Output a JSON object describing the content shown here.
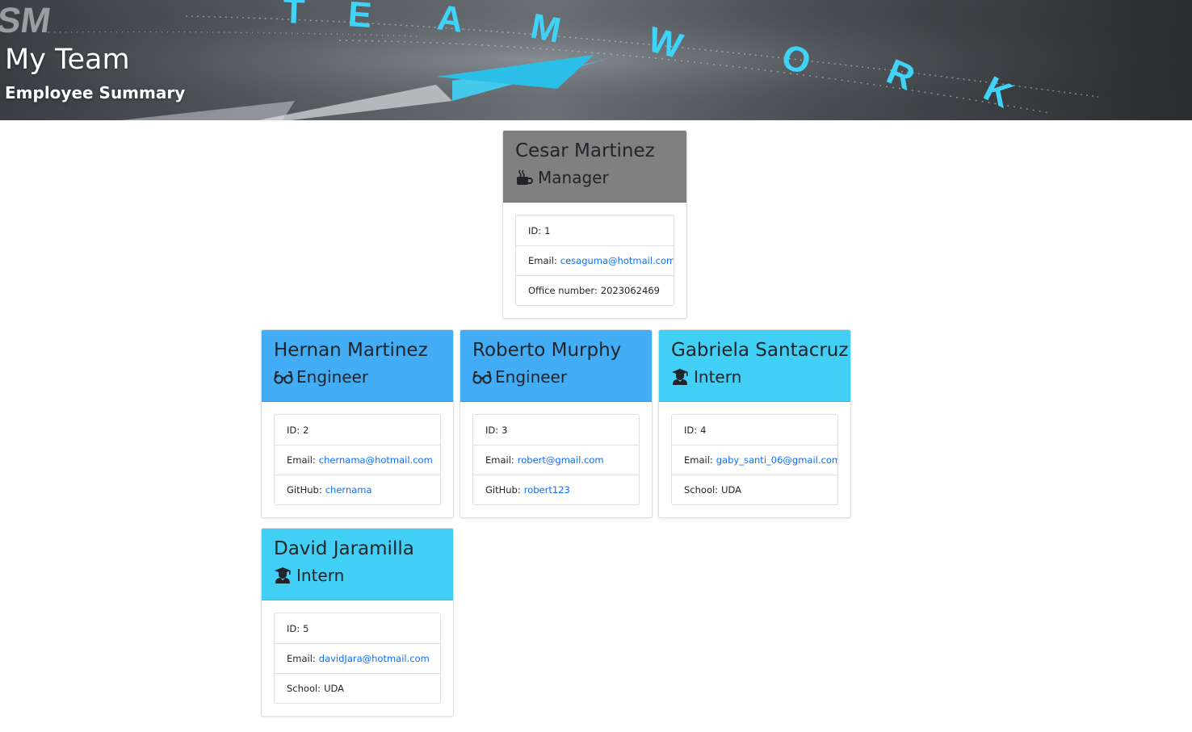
{
  "header": {
    "title": "My Team",
    "subtitle": "Employee Summary",
    "banner_text": "TEAMWORK"
  },
  "colors": {
    "manager_header": "#808080",
    "engineer_header": "#42adf5",
    "intern_header": "#42cff5",
    "link": "#0d6efd"
  },
  "labels": {
    "id": "ID:",
    "email": "Email:",
    "office": "Office number:",
    "github": "GitHub:",
    "school": "School:"
  },
  "employees": [
    {
      "name": "Cesar Martinez",
      "role": "Manager",
      "icon": "mug-hot-icon",
      "id": "1",
      "email": "cesaguma@hotmail.com",
      "extra_value": "2023062469"
    },
    {
      "name": "Hernan Martinez",
      "role": "Engineer",
      "icon": "glasses-icon",
      "id": "2",
      "email": "chernama@hotmail.com",
      "extra_value": "chernama"
    },
    {
      "name": "Roberto Murphy",
      "role": "Engineer",
      "icon": "glasses-icon",
      "id": "3",
      "email": "robert@gmail.com",
      "extra_value": "robert123"
    },
    {
      "name": "Gabriela Santacruz",
      "role": "Intern",
      "icon": "graduate-icon",
      "id": "4",
      "email": "gaby_santi_06@gmail.com",
      "extra_value": "UDA"
    },
    {
      "name": "David Jaramilla",
      "role": "Intern",
      "icon": "graduate-icon",
      "id": "5",
      "email": "davidJara@hotmail.com",
      "extra_value": "UDA"
    }
  ]
}
